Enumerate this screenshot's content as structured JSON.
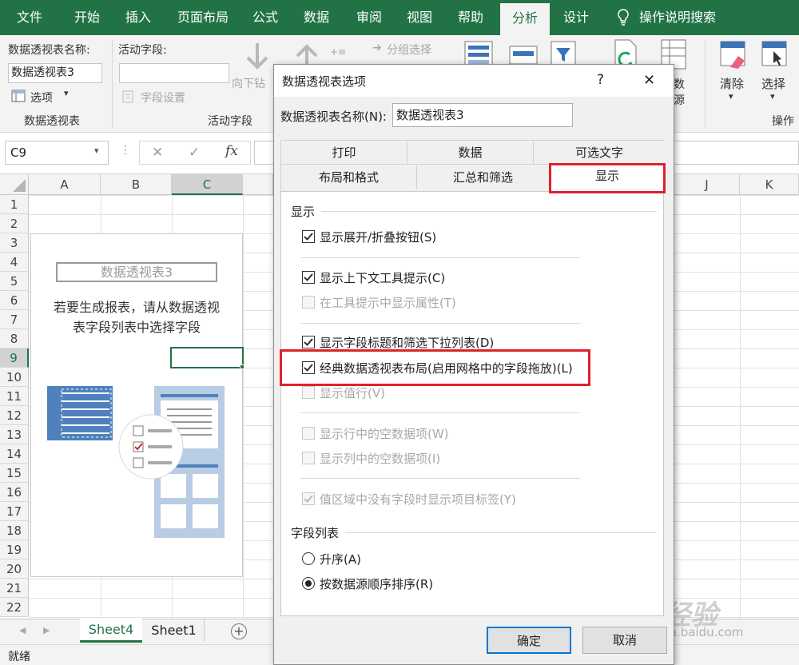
{
  "menu": {
    "tabs": [
      "文件",
      "开始",
      "插入",
      "页面布局",
      "公式",
      "数据",
      "审阅",
      "视图",
      "帮助",
      "分析",
      "设计"
    ],
    "active": "分析",
    "search": "操作说明搜索"
  },
  "ribbon": {
    "pt_name_label": "数据透视表名称:",
    "pt_name_value": "数据透视表3",
    "options_label": "选项",
    "group_pivottable": "数据透视表",
    "active_field_label": "活动字段:",
    "field_settings": "字段设置",
    "drilldown": "向下钻",
    "group_active_field": "活动字段",
    "group_selection": "分组选择",
    "source_frag": "数",
    "source_frag2": "源",
    "clear": "清除",
    "select": "选择",
    "group_actions": "操作"
  },
  "formula": {
    "namebox": "C9",
    "fx": "fx"
  },
  "columns": [
    "A",
    "B",
    "C",
    "J",
    "K"
  ],
  "rows": [
    "1",
    "2",
    "3",
    "4",
    "5",
    "6",
    "7",
    "8",
    "9",
    "10",
    "11",
    "12",
    "13",
    "14",
    "15",
    "16",
    "17",
    "18",
    "19",
    "20",
    "21",
    "22"
  ],
  "placeholder": {
    "title": "数据透视表3",
    "instruction_line1": "若要生成报表，请从数据透视",
    "instruction_line2": "表字段列表中选择字段"
  },
  "sheets": {
    "tabs": [
      "Sheet4",
      "Sheet1"
    ],
    "active": "Sheet4"
  },
  "status": "就绪",
  "dialog": {
    "title": "数据透视表选项",
    "help": "?",
    "close": "✕",
    "name_label": "数据透视表名称(N):",
    "name_value": "数据透视表3",
    "tabs_row1": [
      "打印",
      "数据",
      "可选文字"
    ],
    "tabs_row2": [
      "布局和格式",
      "汇总和筛选",
      "显示"
    ],
    "active_tab": "显示",
    "section_display": "显示",
    "opt_expand": "显示展开/折叠按钮(S)",
    "opt_tooltip": "显示上下文工具提示(C)",
    "opt_props": "在工具提示中显示属性(T)",
    "opt_captions": "显示字段标题和筛选下拉列表(D)",
    "opt_classic": "经典数据透视表布局(启用网格中的字段拖放)(L)",
    "opt_values_row": "显示值行(V)",
    "opt_empty_rows": "显示行中的空数据项(W)",
    "opt_empty_cols": "显示列中的空数据项(I)",
    "opt_item_labels": "值区域中没有字段时显示项目标签(Y)",
    "section_fieldlist": "字段列表",
    "sort_az": "升序(A)",
    "sort_source": "按数据源顺序排序(R)",
    "ok": "确定",
    "cancel": "取消"
  },
  "watermark": {
    "brand": "Bai 经验",
    "url": "jingyan.baidu.com"
  },
  "colors": {
    "excel_green": "#217346",
    "highlight_red": "#e0212b",
    "ok_border": "#0078d7"
  }
}
